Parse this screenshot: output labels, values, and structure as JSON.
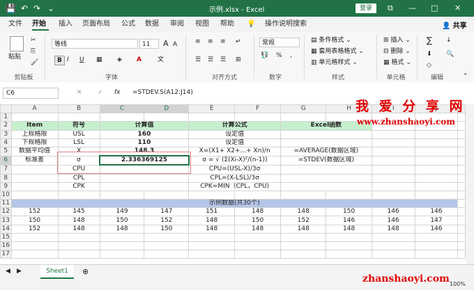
{
  "titlebar": {
    "title": "示例.xlsx  -  Excel",
    "login": "登录",
    "qa_save": "💾",
    "qa_undo": "↶",
    "qa_redo": "↷",
    "qa_more": "⌄",
    "restore": "⧉",
    "minimize": "—",
    "maximize": "□",
    "close": "✕"
  },
  "tabs": [
    "文件",
    "开始",
    "插入",
    "页面布局",
    "公式",
    "数据",
    "审阅",
    "视图",
    "帮助"
  ],
  "tell_me": "操作说明搜索",
  "share": "共享",
  "ribbon": {
    "paste": "粘贴",
    "clipboard": "剪贴板",
    "font_name": "等线",
    "font_size": "11",
    "font_grow": "A",
    "font_shrink": "A",
    "bold": "B",
    "italic": "I",
    "underline": "U",
    "font": "字体",
    "alignment": "对齐方式",
    "number_format": "常规",
    "percent": "%",
    "number": "数字",
    "cond_format": "条件格式",
    "table_format": "套用表格格式",
    "cell_style": "单元格样式",
    "styles": "样式",
    "insert": "插入",
    "delete": "删除",
    "format": "格式",
    "cells": "单元格",
    "editing": "编辑",
    "sum": "∑",
    "sort": "↓"
  },
  "formula_bar": {
    "cell": "C6",
    "cancel": "✕",
    "confirm": "✓",
    "fx": "fx",
    "formula": "=STDEV.S(A12:J14)"
  },
  "columns": [
    "A",
    "B",
    "C",
    "D",
    "E",
    "F",
    "G",
    "H",
    "I",
    "J"
  ],
  "rows": {
    "r2": [
      "Item",
      "符号",
      "计算值",
      "计算公式",
      "Excel函数"
    ],
    "r3": [
      "上规格限",
      "USL",
      "160",
      "设定值"
    ],
    "r4": [
      "下规格限",
      "LSL",
      "110",
      "设定值"
    ],
    "r5": [
      "数据平均值",
      "X",
      "148.3",
      "X=(X1+ X2+...+ Xn)/n",
      "=AVERAGE(数据区域)"
    ],
    "r6": [
      "标准差",
      "σ",
      "2.336369125",
      "σ = √ (Σ(Xi-X)²/(n-1))",
      "=STDEV(数据区域)"
    ],
    "r7": [
      "CPU",
      "CPU=(USL-X)/3σ"
    ],
    "r8": [
      "CPL",
      "CPL=(X-LSL)/3σ"
    ],
    "r9": [
      "CPK",
      "CPK=MIN（CPL，CPU)"
    ],
    "r11": "示例数据(共30个)",
    "r12": [
      "152",
      "145",
      "149",
      "147",
      "151",
      "148",
      "148",
      "150",
      "146",
      "146"
    ],
    "r13": [
      "150",
      "148",
      "150",
      "152",
      "148",
      "150",
      "152",
      "146",
      "146",
      "147"
    ],
    "r14": [
      "152",
      "148",
      "148",
      "150",
      "148",
      "148",
      "148",
      "148",
      "148",
      "146"
    ]
  },
  "row_numbers": [
    "1",
    "2",
    "3",
    "4",
    "5",
    "6",
    "7",
    "8",
    "9",
    "10",
    "11",
    "12",
    "13",
    "14",
    "15",
    "16",
    "17"
  ],
  "sheet_tab": "Sheet1",
  "zoom": "100%",
  "watermark": {
    "title": "我 爱 分 享 网",
    "url": "www.zhanshaoyi.com",
    "url2": "zhanshaoyi.com"
  }
}
